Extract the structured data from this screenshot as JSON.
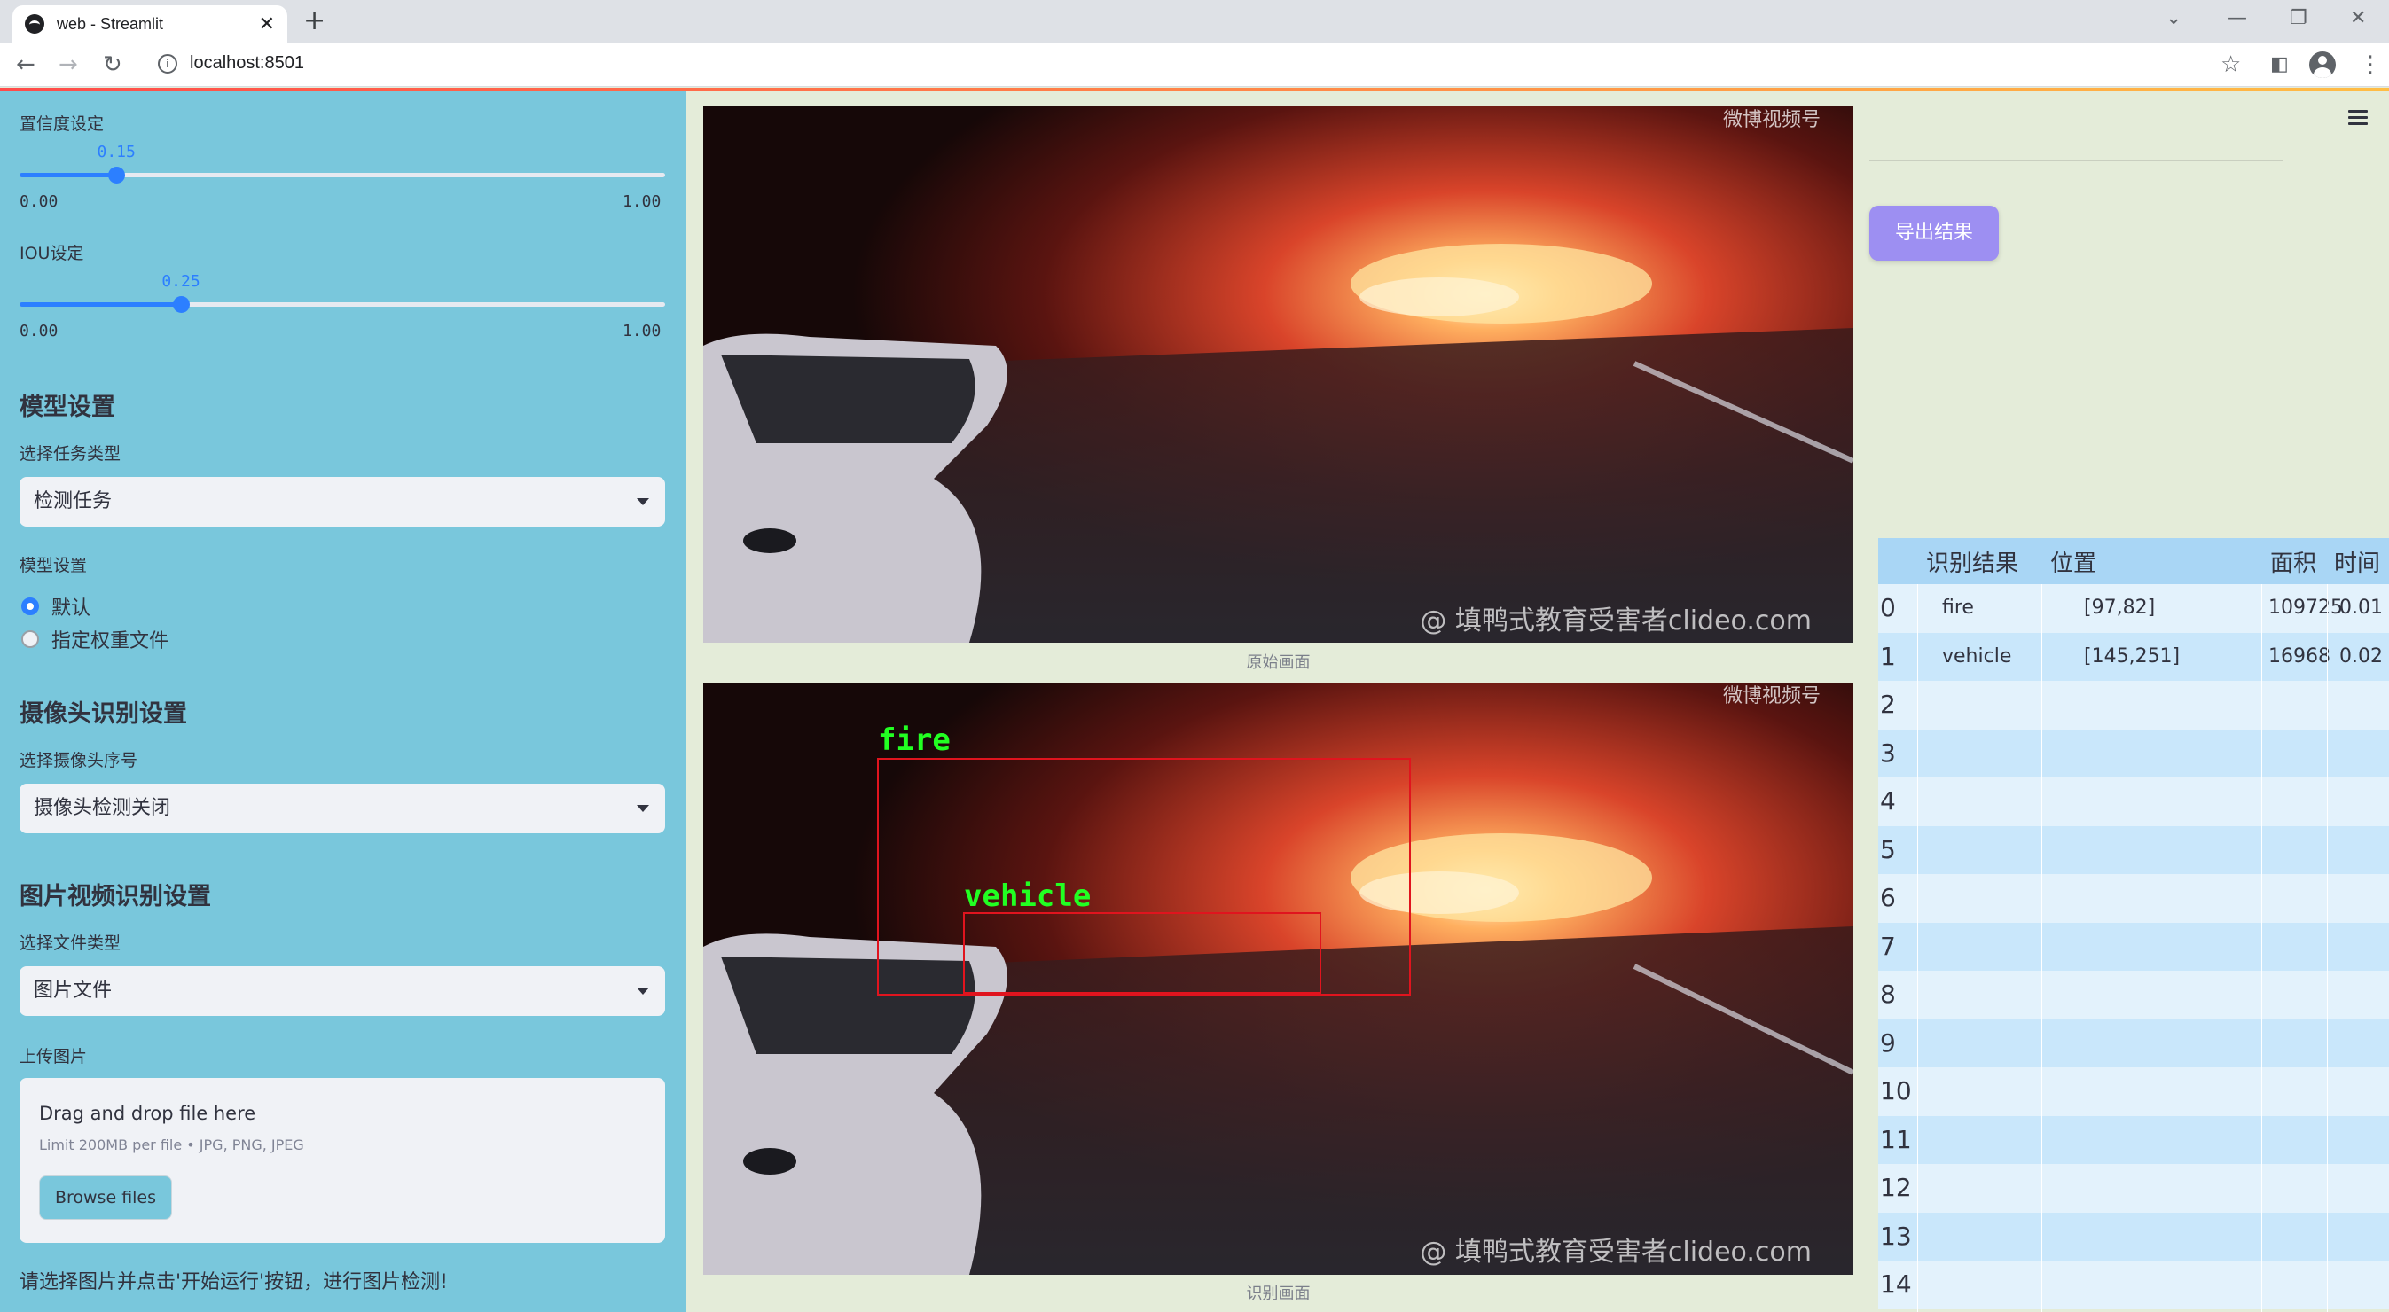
{
  "browser": {
    "tab_title": "web - Streamlit",
    "url": "localhost:8501"
  },
  "sidebar": {
    "confidence": {
      "label": "置信度设定",
      "value": "0.15",
      "fraction": 0.15,
      "min": "0.00",
      "max": "1.00"
    },
    "iou": {
      "label": "IOU设定",
      "value": "0.25",
      "fraction": 0.25,
      "min": "0.00",
      "max": "1.00"
    },
    "model_section": {
      "heading": "模型设置",
      "task_label": "选择任务类型",
      "task_value": "检测任务",
      "model_label": "模型设置",
      "options": [
        "默认",
        "指定权重文件"
      ],
      "selected_index": 0
    },
    "camera_section": {
      "heading": "摄像头识别设置",
      "cam_label": "选择摄像头序号",
      "cam_value": "摄像头检测关闭"
    },
    "file_section": {
      "heading": "图片视频识别设置",
      "type_label": "选择文件类型",
      "type_value": "图片文件",
      "upload_label": "上传图片",
      "drop_text": "Drag and drop file here",
      "limit_text": "Limit 200MB per file • JPG, PNG, JPEG",
      "browse_label": "Browse files"
    },
    "note": "请选择图片并点击'开始运行'按钮，进行图片检测!"
  },
  "main": {
    "original_caption": "原始画面",
    "detected_caption": "识别画面",
    "watermark_top": "微博视频号",
    "watermark_bottom": "@ 填鸭式教育受害者clideo.com",
    "detections": [
      {
        "label": "fire"
      },
      {
        "label": "vehicle"
      }
    ]
  },
  "results": {
    "export_label": "导出结果",
    "columns": [
      "识别结果",
      "位置",
      "面积",
      "时间"
    ],
    "rows": [
      {
        "idx": "0",
        "result": "fire",
        "position": "[97,82]",
        "area": "109725",
        "time": "0.01"
      },
      {
        "idx": "1",
        "result": "vehicle",
        "position": "[145,251]",
        "area": "16968",
        "time": "0.02"
      },
      {
        "idx": "2",
        "result": "",
        "position": "",
        "area": "",
        "time": ""
      },
      {
        "idx": "3",
        "result": "",
        "position": "",
        "area": "",
        "time": ""
      },
      {
        "idx": "4",
        "result": "",
        "position": "",
        "area": "",
        "time": ""
      },
      {
        "idx": "5",
        "result": "",
        "position": "",
        "area": "",
        "time": ""
      },
      {
        "idx": "6",
        "result": "",
        "position": "",
        "area": "",
        "time": ""
      },
      {
        "idx": "7",
        "result": "",
        "position": "",
        "area": "",
        "time": ""
      },
      {
        "idx": "8",
        "result": "",
        "position": "",
        "area": "",
        "time": ""
      },
      {
        "idx": "9",
        "result": "",
        "position": "",
        "area": "",
        "time": ""
      },
      {
        "idx": "10",
        "result": "",
        "position": "",
        "area": "",
        "time": ""
      },
      {
        "idx": "11",
        "result": "",
        "position": "",
        "area": "",
        "time": ""
      },
      {
        "idx": "12",
        "result": "",
        "position": "",
        "area": "",
        "time": ""
      },
      {
        "idx": "13",
        "result": "",
        "position": "",
        "area": "",
        "time": ""
      },
      {
        "idx": "14",
        "result": "",
        "position": "",
        "area": "",
        "time": ""
      }
    ]
  },
  "colors": {
    "sidebar_bg": "#79c7dc",
    "main_bg": "#e4ecd9",
    "accent": "#2c7fff",
    "export_btn": "#9d8ff2",
    "box_color": "#e0141e",
    "label_color": "#22ff22"
  }
}
